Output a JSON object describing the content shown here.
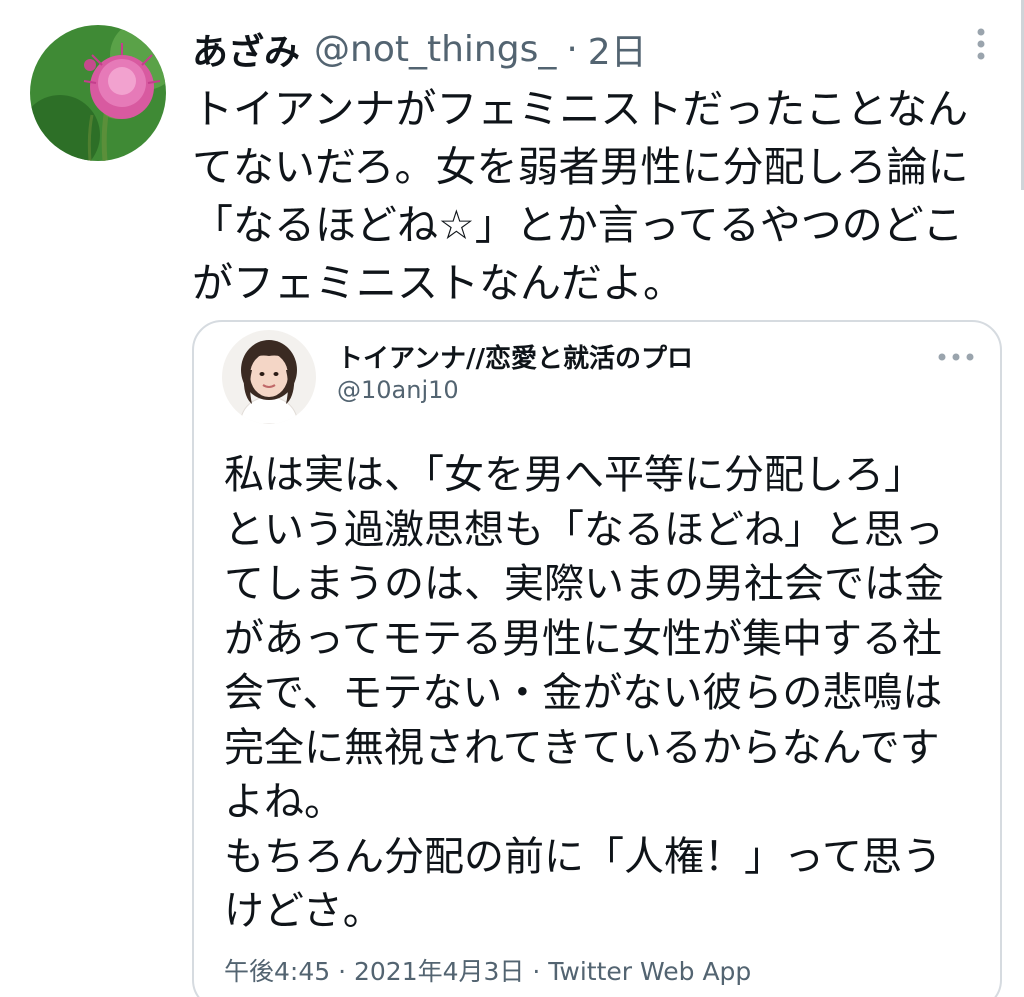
{
  "tweet": {
    "author_name": "あざみ",
    "author_handle": "@not_things_",
    "separator": "·",
    "time": "2日",
    "text": "トイアンナがフェミニストだったことなん\nてないだろ。女を弱者男性に分配しろ論に\n「なるほどね☆」とか言ってるやつのどこ\nがフェミニストなんだよ。",
    "avatar_icon": "thistle-flower-avatar",
    "more_icon": "more-vertical-icon"
  },
  "quoted_tweet": {
    "author_name": "トイアンナ//恋愛と就活のプロ",
    "author_handle": "@10anj10",
    "text": "私は実は、「女を男へ平等に分配しろ」\nという過激思想も「なるほどね」と思っ\nてしまうのは、実際いまの男社会では金\nがあってモテる男性に女性が集中する社\n会で、モテない・金がない彼らの悲鳴は\n完全に無視されてきているからなんです\nよね。\nもちろん分配の前に「人権！」って思う\nけどさ。",
    "meta": "午後4:45 · 2021年4月3日 · Twitter Web App",
    "avatar_icon": "woman-portrait-avatar",
    "more_icon": "more-horizontal-icon"
  },
  "colors": {
    "text_primary": "#0f1419",
    "text_secondary": "#536471",
    "border": "#d6dbe0"
  }
}
